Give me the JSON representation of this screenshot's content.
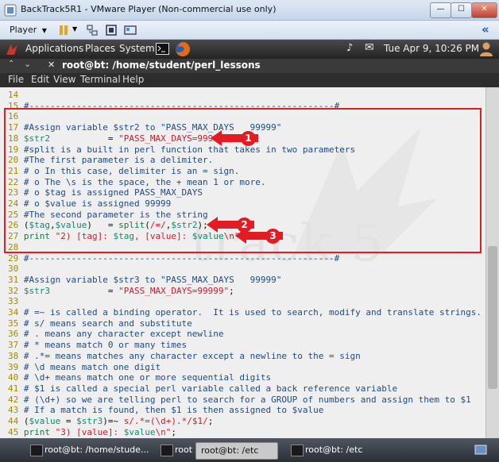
{
  "vm_window": {
    "title": "BackTrack5R1 - VMware Player (Non-commercial use only)",
    "min_glyph": "—",
    "max_glyph": "☐",
    "close_glyph": "✕"
  },
  "vm_toolbar": {
    "player_menu": "Player",
    "collapse_glyph": "«"
  },
  "gnome_panel": {
    "applications": "Applications",
    "places": "Places",
    "system": "System",
    "datetime": "Tue Apr  9, 10:26 PM"
  },
  "terminal": {
    "title": "root@bt: /home/student/perl_lessons",
    "menu": [
      "File",
      "Edit",
      "View",
      "Terminal",
      "Help"
    ],
    "watermark": "track 5",
    "lines": [
      {
        "n": "14",
        "segs": []
      },
      {
        "n": "15",
        "segs": [
          {
            "c": "cm",
            "t": "#----------------------------------------------------------#"
          }
        ]
      },
      {
        "n": "16",
        "segs": []
      },
      {
        "n": "17",
        "segs": [
          {
            "c": "cm",
            "t": "#Assign variable $str2 to \"PASS_MAX_DAYS   99999\""
          }
        ]
      },
      {
        "n": "18",
        "segs": [
          {
            "c": "vr",
            "t": "$str2"
          },
          {
            "c": "pl",
            "t": "           = "
          },
          {
            "c": "st",
            "t": "\"PASS_MAX_DAYS=99999\""
          },
          {
            "c": "pl",
            "t": ";"
          }
        ]
      },
      {
        "n": "19",
        "segs": [
          {
            "c": "cm",
            "t": "#split is a built in perl function that takes in two parameters"
          }
        ]
      },
      {
        "n": "20",
        "segs": [
          {
            "c": "cm",
            "t": "#The first parameter is a delimiter."
          }
        ]
      },
      {
        "n": "21",
        "segs": [
          {
            "c": "cm",
            "t": "# o In this case, delimiter is an = sign."
          }
        ]
      },
      {
        "n": "22",
        "segs": [
          {
            "c": "cm",
            "t": "# o The \\s is the space, the + mean 1 or more."
          }
        ]
      },
      {
        "n": "23",
        "segs": [
          {
            "c": "cm",
            "t": "# o $tag is assigned PASS_MAX_DAYS"
          }
        ]
      },
      {
        "n": "24",
        "segs": [
          {
            "c": "cm",
            "t": "# o $value is assigned 99999"
          }
        ]
      },
      {
        "n": "25",
        "segs": [
          {
            "c": "cm",
            "t": "#The second parameter is the string"
          }
        ]
      },
      {
        "n": "26",
        "segs": [
          {
            "c": "pl",
            "t": "("
          },
          {
            "c": "vr",
            "t": "$tag"
          },
          {
            "c": "pl",
            "t": ","
          },
          {
            "c": "vr",
            "t": "$value"
          },
          {
            "c": "pl",
            "t": ")   = "
          },
          {
            "c": "kw",
            "t": "split"
          },
          {
            "c": "pl",
            "t": "("
          },
          {
            "c": "st",
            "t": "/=/"
          },
          {
            "c": "pl",
            "t": ","
          },
          {
            "c": "vr",
            "t": "$str2"
          },
          {
            "c": "pl",
            "t": ");"
          }
        ]
      },
      {
        "n": "27",
        "segs": [
          {
            "c": "kw",
            "t": "print"
          },
          {
            "c": "pl",
            "t": " "
          },
          {
            "c": "st",
            "t": "\"2) [tag]: "
          },
          {
            "c": "vr",
            "t": "$tag"
          },
          {
            "c": "st",
            "t": ", [value]: "
          },
          {
            "c": "vr",
            "t": "$value"
          },
          {
            "c": "st",
            "t": "\\n\""
          },
          {
            "c": "pl",
            "t": ";"
          }
        ]
      },
      {
        "n": "28",
        "segs": []
      },
      {
        "n": "29",
        "segs": [
          {
            "c": "cm",
            "t": "#----------------------------------------------------------#"
          }
        ]
      },
      {
        "n": "30",
        "segs": []
      },
      {
        "n": "31",
        "segs": [
          {
            "c": "cm",
            "t": "#Assign variable $str3 to \"PASS_MAX_DAYS   99999\""
          }
        ]
      },
      {
        "n": "32",
        "segs": [
          {
            "c": "vr",
            "t": "$str3"
          },
          {
            "c": "pl",
            "t": "           = "
          },
          {
            "c": "st",
            "t": "\"PASS_MAX_DAYS=99999\""
          },
          {
            "c": "pl",
            "t": ";"
          }
        ]
      },
      {
        "n": "33",
        "segs": []
      },
      {
        "n": "34",
        "segs": [
          {
            "c": "cm",
            "t": "# =~ is called a binding operator.  It is used to search, modify and translate strings."
          }
        ]
      },
      {
        "n": "35",
        "segs": [
          {
            "c": "cm",
            "t": "# s/ means search and substitute"
          }
        ]
      },
      {
        "n": "36",
        "segs": [
          {
            "c": "cm",
            "t": "# . means any character except newline"
          }
        ]
      },
      {
        "n": "37",
        "segs": [
          {
            "c": "cm",
            "t": "# * means match 0 or many times"
          }
        ]
      },
      {
        "n": "38",
        "segs": [
          {
            "c": "cm",
            "t": "# .*= means matches any character except a newline to the = sign"
          }
        ]
      },
      {
        "n": "39",
        "segs": [
          {
            "c": "cm",
            "t": "# \\d means match one digit"
          }
        ]
      },
      {
        "n": "40",
        "segs": [
          {
            "c": "cm",
            "t": "# \\d+ means match one or more sequential digits"
          }
        ]
      },
      {
        "n": "41",
        "segs": [
          {
            "c": "cm",
            "t": "# $1 is called a special perl variable called a back reference variable"
          }
        ]
      },
      {
        "n": "42",
        "segs": [
          {
            "c": "cm",
            "t": "# (\\d+) so we are telling perl to search for a GROUP of numbers and assign them to $1"
          }
        ]
      },
      {
        "n": "43",
        "segs": [
          {
            "c": "cm",
            "t": "# If a match is found, then $1 is then assigned to $value"
          }
        ]
      },
      {
        "n": "44",
        "segs": [
          {
            "c": "pl",
            "t": "("
          },
          {
            "c": "vr",
            "t": "$value"
          },
          {
            "c": "pl",
            "t": " = "
          },
          {
            "c": "vr",
            "t": "$str3"
          },
          {
            "c": "pl",
            "t": ")=~ "
          },
          {
            "c": "st",
            "t": "s/.*=(\\d+).*/$1/"
          },
          {
            "c": "pl",
            "t": ";"
          }
        ]
      },
      {
        "n": "45",
        "segs": [
          {
            "c": "kw",
            "t": "print"
          },
          {
            "c": "pl",
            "t": " "
          },
          {
            "c": "st",
            "t": "\"3) [value]: "
          },
          {
            "c": "vr",
            "t": "$value"
          },
          {
            "c": "st",
            "t": "\\n\""
          },
          {
            "c": "pl",
            "t": ";"
          }
        ]
      }
    ]
  },
  "annotations": [
    {
      "label": "1"
    },
    {
      "label": "2"
    },
    {
      "label": "3"
    }
  ],
  "taskbar": {
    "tasks": [
      "root@bt: /home/stude...",
      "root",
      "root@bt: /etc",
      "root@bt: /etc"
    ]
  },
  "colors": {
    "highlight": "#e31b23",
    "comment": "#1e4a86",
    "variable": "#0f8a72",
    "string": "#d11a2a",
    "keyword": "#0f7a4a",
    "line_number": "#a38a00"
  }
}
